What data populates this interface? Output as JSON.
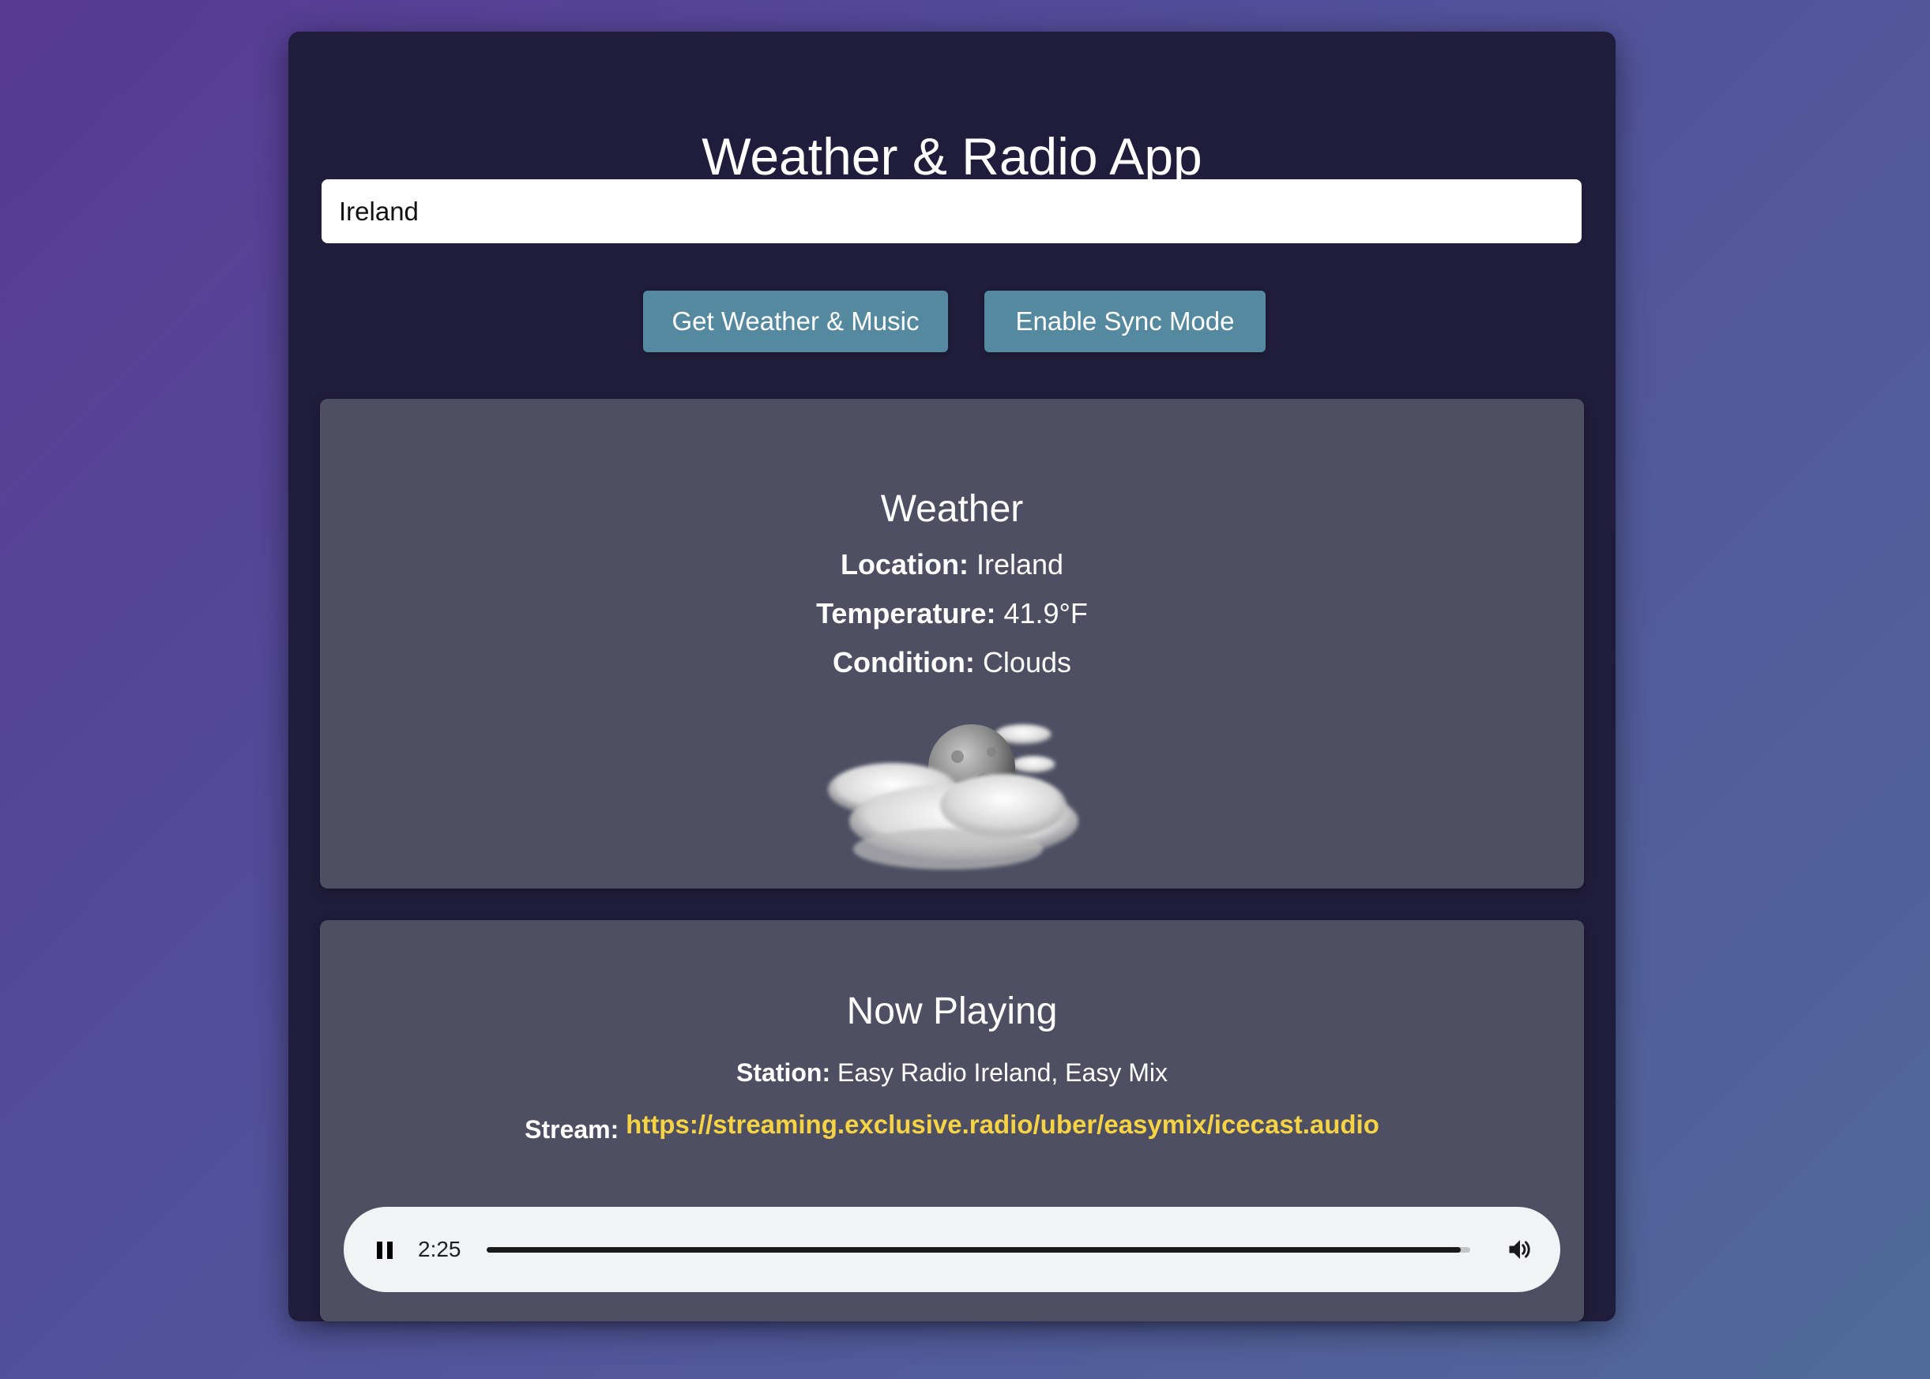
{
  "app": {
    "title": "Weather & Radio App"
  },
  "search": {
    "value": "Ireland"
  },
  "buttons": {
    "get_weather_label": "Get Weather & Music",
    "sync_mode_label": "Enable Sync Mode"
  },
  "weather": {
    "heading": "Weather",
    "location_label": "Location:",
    "location_value": "Ireland",
    "temperature_label": "Temperature:",
    "temperature_value": "41.9°F",
    "condition_label": "Condition:",
    "condition_value": "Clouds",
    "icon": "cloudy-night-moon-icon"
  },
  "music": {
    "heading": "Now Playing",
    "station_label": "Station:",
    "station_value": "Easy Radio Ireland, Easy Mix",
    "stream_label": "Stream:",
    "stream_url": "https://streaming.exclusive.radio/uber/easymix/icecast.audio"
  },
  "player": {
    "state_icon": "pause-icon",
    "time": "2:25",
    "progress_fraction": 0.99,
    "volume_icon": "volume-icon"
  },
  "colors": {
    "card_bg": "#201c3b",
    "panel_bg": "#4f4f64",
    "button_bg": "#5489a0",
    "link": "#f5d342",
    "player_bg": "#f1f3f4"
  }
}
